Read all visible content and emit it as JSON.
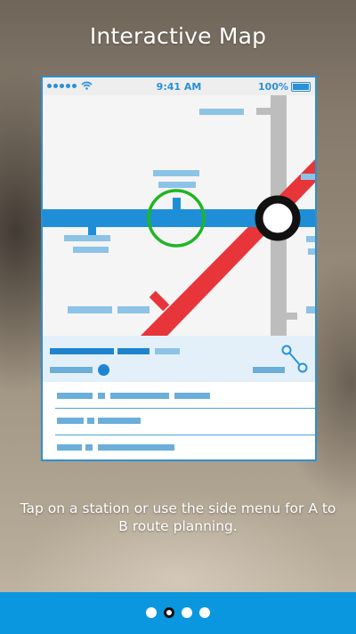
{
  "header": {
    "title": "Interactive Map"
  },
  "phone": {
    "status_bar": {
      "time": "9:41 AM",
      "battery": "100%"
    }
  },
  "caption": "Tap on a station or use the side menu for A to B route planning.",
  "pager": {
    "page_count": 4,
    "current_index": 1
  },
  "colors": {
    "accent": "#0b97e0",
    "blue_line": "#1e8fd6",
    "red_line": "#e8353a",
    "grey_line": "#bdbdbd",
    "highlight_ring": "#1fb526"
  },
  "icons": {
    "signal": "signal-dots-icon",
    "wifi": "wifi-icon",
    "battery": "battery-icon",
    "route": "route-icon",
    "selected_station": "station-ring-icon",
    "interchange": "interchange-station-icon"
  }
}
